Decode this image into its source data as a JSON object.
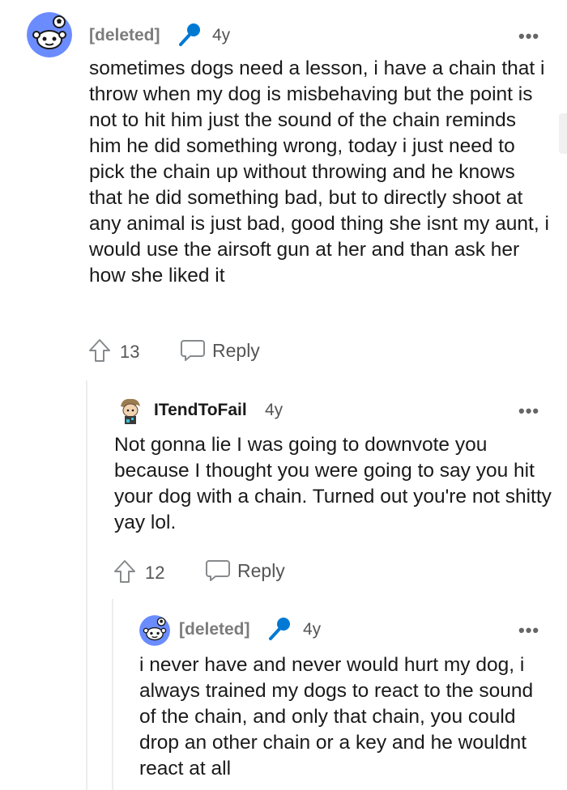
{
  "comments": [
    {
      "username": "[deleted]",
      "age": "4y",
      "text": "sometimes dogs need a lesson, i have a chain that i throw when my dog is misbehaving but the point is not to hit him just the sound of the chain reminds him he did something wrong, today i just need to pick the chain up without throwing and he knows that he did something bad, but to directly shoot at any animal is just bad, good thing she isnt my aunt, i would use the airsoft gun at her and than ask her how she liked it",
      "votes": "13",
      "reply_label": "Reply",
      "more": "•••"
    },
    {
      "username": "ITendToFail",
      "age": "4y",
      "text": "Not gonna lie I was going to downvote you because I thought you were going to say you hit your dog with a chain. Turned out you're not shitty yay lol.",
      "votes": "12",
      "reply_label": "Reply",
      "more": "•••"
    },
    {
      "username": "[deleted]",
      "age": "4y",
      "text": "i never have and never would hurt my dog, i always trained my dogs to react to the sound of the chain, and only that chain, you could drop an other chain or a key and he wouldnt react at all",
      "more": "•••"
    }
  ],
  "colors": {
    "avatar_bg": "#6b8cff",
    "mic": "#0079d3",
    "text": "#1a1a1b",
    "muted": "#7c7c7c"
  },
  "icons": {
    "avatar": "snoo-avatar-icon",
    "mic": "microphone-icon",
    "upvote": "upvote-arrow-icon",
    "reply": "speech-bubble-icon"
  }
}
